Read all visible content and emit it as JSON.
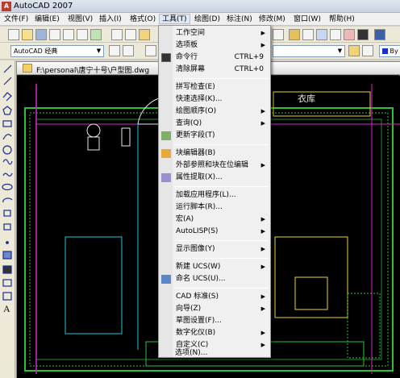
{
  "window": {
    "title": "AutoCAD 2007"
  },
  "menubar": [
    {
      "label": "文件(F)"
    },
    {
      "label": "编辑(E)"
    },
    {
      "label": "视图(V)"
    },
    {
      "label": "插入(I)"
    },
    {
      "label": "格式(O)"
    },
    {
      "label": "工具(T)"
    },
    {
      "label": "绘图(D)"
    },
    {
      "label": "标注(N)"
    },
    {
      "label": "修改(M)"
    },
    {
      "label": "窗口(W)"
    },
    {
      "label": "帮助(H)"
    }
  ],
  "toolbar2": {
    "workspace": "AutoCAD 经典",
    "layer_right": "By"
  },
  "document": {
    "path": "F:\\personal\\唐宁十号\\户型图.dwg",
    "room_label": "衣库"
  },
  "tools_menu": {
    "items": [
      {
        "label": "工作空间",
        "submenu": true
      },
      {
        "label": "选项板",
        "submenu": true
      },
      {
        "label": "命令行",
        "shortcut": "CTRL+9",
        "icon": "command-line-icon"
      },
      {
        "label": "清除屏幕",
        "shortcut": "CTRL+0"
      },
      {
        "label": "拼写检查(E)"
      },
      {
        "label": "快速选择(K)..."
      },
      {
        "label": "绘图顺序(O)",
        "submenu": true
      },
      {
        "label": "查询(Q)",
        "submenu": true
      },
      {
        "label": "更新字段(T)",
        "icon": "update-fields-icon"
      },
      {
        "label": "块编辑器(B)",
        "icon": "block-editor-icon"
      },
      {
        "label": "外部参照和块在位编辑",
        "submenu": true
      },
      {
        "label": "属性提取(X)...",
        "icon": "attribute-extract-icon"
      },
      {
        "label": "加载应用程序(L)..."
      },
      {
        "label": "运行脚本(R)..."
      },
      {
        "label": "宏(A)",
        "submenu": true
      },
      {
        "label": "AutoLISP(S)",
        "submenu": true
      },
      {
        "label": "显示图像(Y)",
        "submenu": true
      },
      {
        "label": "新建 UCS(W)",
        "submenu": true
      },
      {
        "label": "命名 UCS(U)...",
        "icon": "named-ucs-icon"
      },
      {
        "label": "CAD 标准(S)",
        "submenu": true
      },
      {
        "label": "向导(Z)",
        "submenu": true
      },
      {
        "label": "草图设置(F)..."
      },
      {
        "label": "数字化仪(B)",
        "submenu": true
      },
      {
        "label": "自定义(C)",
        "submenu": true
      },
      {
        "label": "选项(N)..."
      }
    ]
  },
  "colors": {
    "menu_bg": "#f0f0f0",
    "canvas_bg": "#000000",
    "wall_green": "#2cc236",
    "magenta": "#d628c8"
  }
}
